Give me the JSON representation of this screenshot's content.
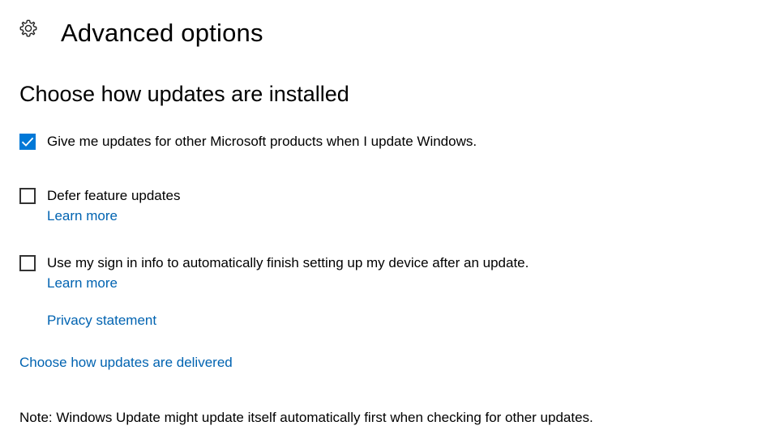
{
  "header": {
    "icon": "gear-icon",
    "title": "Advanced options"
  },
  "section": {
    "title": "Choose how updates are installed"
  },
  "options": [
    {
      "label": "Give me updates for other Microsoft products when I update Windows.",
      "checked": true
    },
    {
      "label": "Defer feature updates",
      "checked": false,
      "link": "Learn more"
    },
    {
      "label": "Use my sign in info to automatically finish setting up my device after an update.",
      "checked": false,
      "link": "Learn more"
    }
  ],
  "links": {
    "privacy": "Privacy statement",
    "delivery": "Choose how updates are delivered"
  },
  "note": "Note: Windows Update might update itself automatically first when checking for other updates.",
  "colors": {
    "accent": "#0078d7",
    "link": "#0063b1"
  }
}
